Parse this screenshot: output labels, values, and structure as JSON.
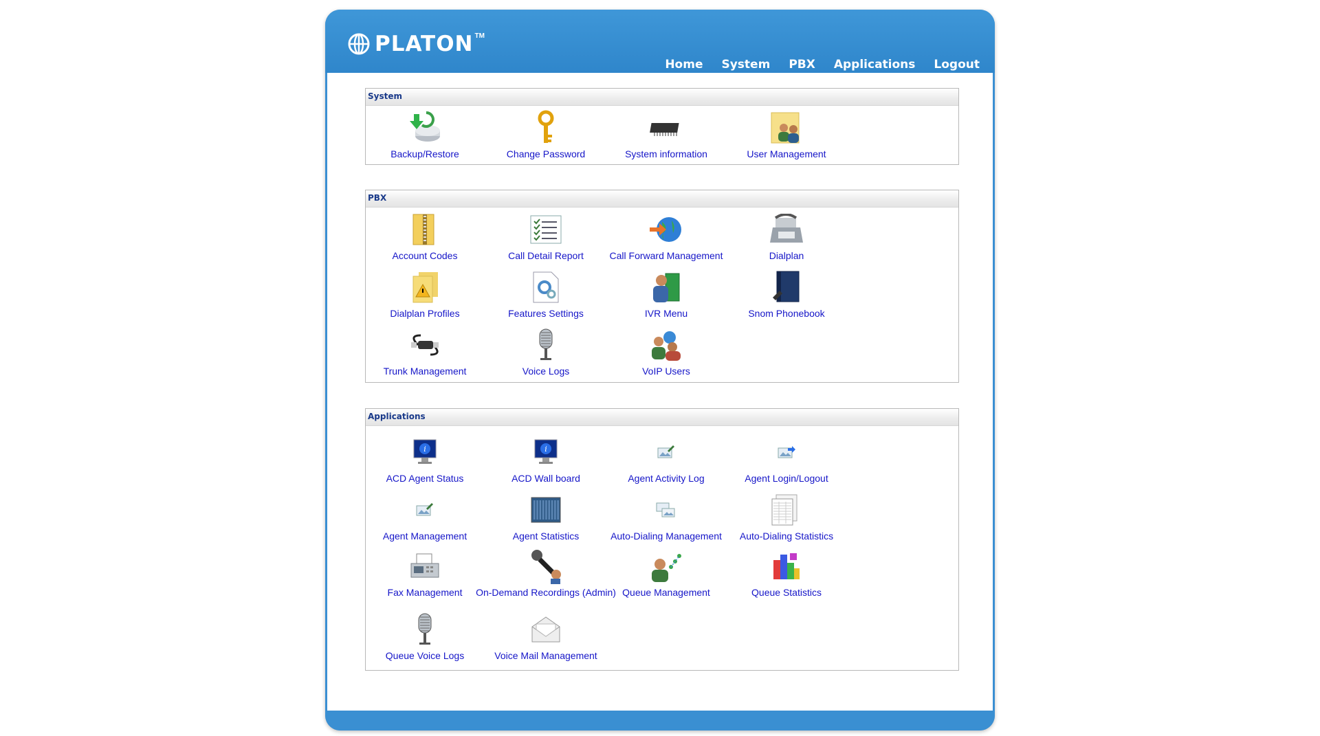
{
  "app": {
    "logo_text": "PLATON",
    "logo_tm": "TM"
  },
  "nav": [
    "Home",
    "System",
    "PBX",
    "Applications",
    "Logout"
  ],
  "sections": {
    "system": {
      "title": "System",
      "items": [
        {
          "label": "Backup/Restore",
          "icon": "backup-restore-icon"
        },
        {
          "label": "Change Password",
          "icon": "key-icon"
        },
        {
          "label": "System information",
          "icon": "chip-icon"
        },
        {
          "label": "User Management",
          "icon": "users-folder-icon"
        }
      ]
    },
    "pbx": {
      "title": "PBX",
      "items": [
        {
          "label": "Account Codes",
          "icon": "zip-folder-icon"
        },
        {
          "label": "Call Detail Report",
          "icon": "checklist-icon"
        },
        {
          "label": "Call Forward Management",
          "icon": "globe-arrow-icon"
        },
        {
          "label": "Dialplan",
          "icon": "fax-phone-icon"
        },
        {
          "label": "Dialplan Profiles",
          "icon": "warning-folder-icon"
        },
        {
          "label": "Features Settings",
          "icon": "gear-document-icon"
        },
        {
          "label": "IVR Menu",
          "icon": "user-book-icon"
        },
        {
          "label": "Snom Phonebook",
          "icon": "phonebook-icon"
        },
        {
          "label": "Trunk Management",
          "icon": "cable-icon"
        },
        {
          "label": "Voice Logs",
          "icon": "microphone-icon"
        },
        {
          "label": "VoIP Users",
          "icon": "voip-users-icon"
        }
      ]
    },
    "applications": {
      "title": "Applications",
      "items": [
        {
          "label": "ACD Agent Status",
          "icon": "monitor-info-icon"
        },
        {
          "label": "ACD Wall board",
          "icon": "monitor-info-icon"
        },
        {
          "label": "Agent Activity Log",
          "icon": "image-edit-icon"
        },
        {
          "label": "Agent Login/Logout",
          "icon": "image-arrow-icon"
        },
        {
          "label": "Agent Management",
          "icon": "image-edit-icon"
        },
        {
          "label": "Agent Statistics",
          "icon": "wallboard-icon"
        },
        {
          "label": "Auto-Dialing Management",
          "icon": "images-icon"
        },
        {
          "label": "Auto-Dialing Statistics",
          "icon": "spreadsheet-icon"
        },
        {
          "label": "Fax Management",
          "icon": "fax-icon"
        },
        {
          "label": "On-Demand Recordings (Admin)",
          "icon": "handheld-mic-icon"
        },
        {
          "label": "Queue Management",
          "icon": "user-network-icon"
        },
        {
          "label": "Queue Statistics",
          "icon": "colorful-blocks-icon"
        },
        {
          "label": "Queue Voice Logs",
          "icon": "microphone-icon"
        },
        {
          "label": "Voice Mail Management",
          "icon": "envelope-icon"
        }
      ]
    }
  }
}
